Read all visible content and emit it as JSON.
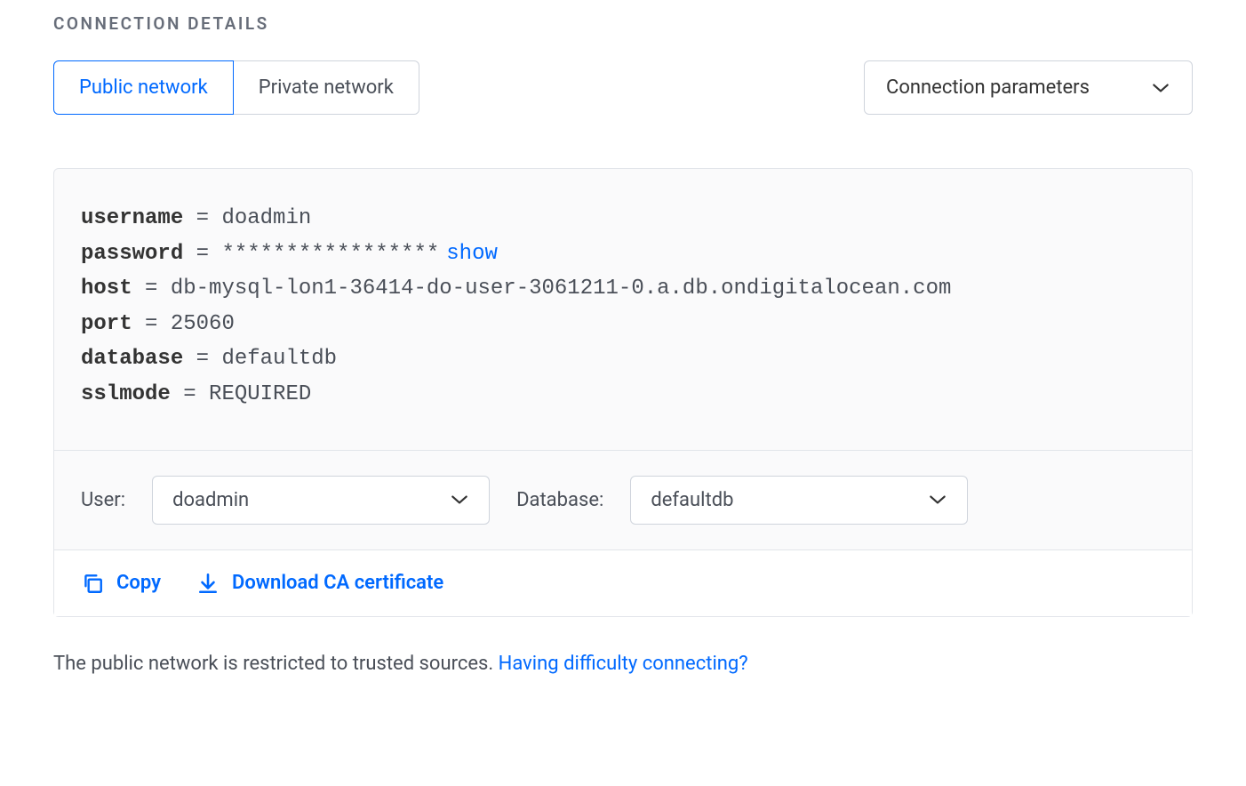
{
  "section_title": "CONNECTION DETAILS",
  "tabs": {
    "public": "Public network",
    "private": "Private network"
  },
  "view_dropdown": {
    "selected": "Connection parameters"
  },
  "connection": {
    "username_key": "username",
    "username_val": "doadmin",
    "password_key": "password",
    "password_val": "*****************",
    "show_label": "show",
    "host_key": "host",
    "host_val": "db-mysql-lon1-36414-do-user-3061211-0.a.db.ondigitalocean.com",
    "port_key": "port",
    "port_val": "25060",
    "database_key": "database",
    "database_val": "defaultdb",
    "sslmode_key": "sslmode",
    "sslmode_val": "REQUIRED"
  },
  "selectors": {
    "user_label": "User:",
    "user_value": "doadmin",
    "database_label": "Database:",
    "database_value": "defaultdb"
  },
  "actions": {
    "copy": "Copy",
    "download_ca": "Download CA certificate"
  },
  "footer": {
    "text": "The public network is restricted to trusted sources. ",
    "link": "Having difficulty connecting?"
  }
}
